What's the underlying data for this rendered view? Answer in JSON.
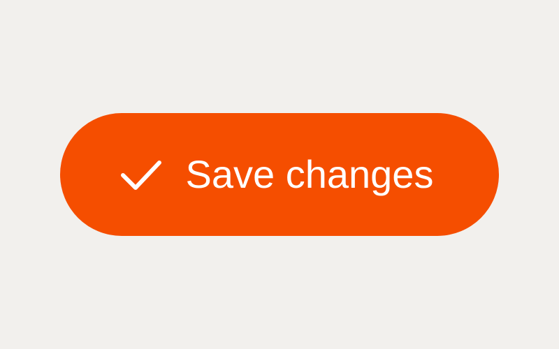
{
  "button": {
    "label": "Save changes",
    "icon": "checkmark-icon",
    "background_color": "#f54e00",
    "text_color": "#ffffff"
  },
  "page": {
    "background_color": "#f2f0ed"
  }
}
